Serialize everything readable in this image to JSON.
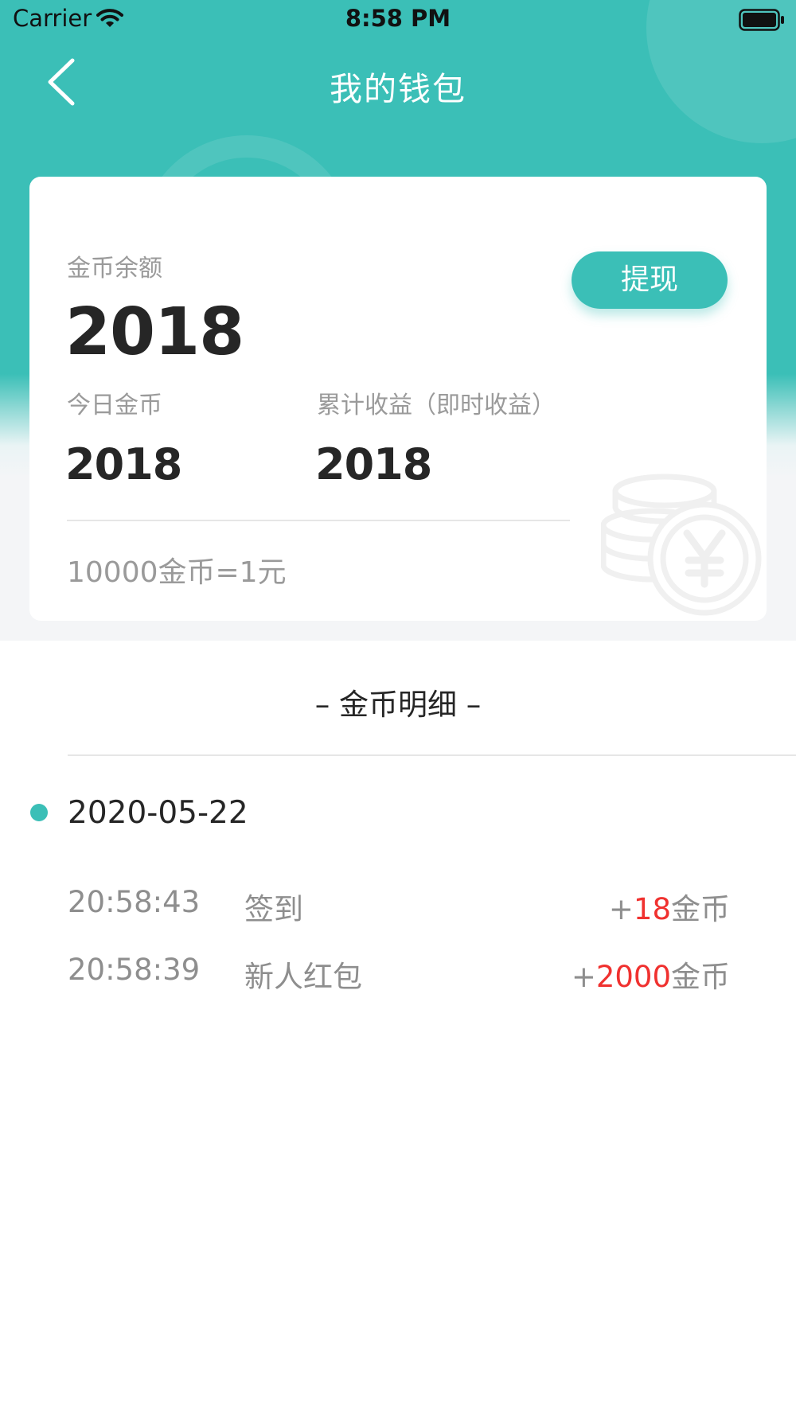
{
  "status_bar": {
    "carrier": "Carrier",
    "time": "8:58 PM"
  },
  "nav": {
    "title": "我的钱包",
    "back_icon": "chevron-left-icon"
  },
  "card": {
    "balance_label": "金币余额",
    "balance_value": "2018",
    "withdraw_label": "提现",
    "today_label": "今日金币",
    "today_value": "2018",
    "total_label": "累计收益（即时收益）",
    "total_value": "2018",
    "rate_text": "10000金币=1元",
    "coin_icon": "coin-yen-icon"
  },
  "details": {
    "title": "– 金币明细 –",
    "date": "2020-05-22",
    "records": [
      {
        "time": "20:58:43",
        "name": "签到",
        "prefix": "+",
        "amount": "18",
        "unit": "金币"
      },
      {
        "time": "20:58:39",
        "name": "新人红包",
        "prefix": "+",
        "amount": "2000",
        "unit": "金币"
      }
    ]
  },
  "colors": {
    "accent": "#3bbfb7",
    "amount": "#f0312f",
    "text_dark": "#262626",
    "text_muted": "#9a9a9a"
  }
}
